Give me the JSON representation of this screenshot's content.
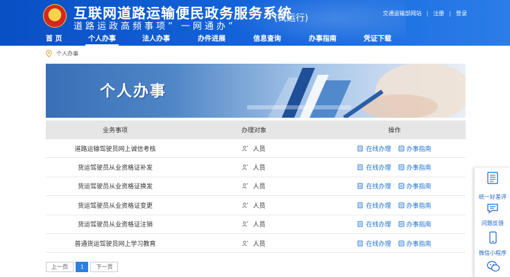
{
  "header": {
    "title": "互联网道路运输便民政务服务系统",
    "slogan": "道路运政高频事项” 一网通办”",
    "trial": "(试运行)",
    "links": [
      "交通运输部网站",
      "注册",
      "登录"
    ],
    "separator": "|"
  },
  "nav": {
    "items": [
      "首 页",
      "个人办事",
      "法人办事",
      "办件进展",
      "信息查询",
      "办事指南",
      "凭证下载"
    ],
    "active_index": 1
  },
  "breadcrumb": {
    "label": "个人办事"
  },
  "banner": {
    "title": "个人办事"
  },
  "table": {
    "headers": [
      "业务事项",
      "办理对象",
      "操作"
    ],
    "rows": [
      {
        "item": "道路运输驾驶员网上诚信考核",
        "target": "人员"
      },
      {
        "item": "货运驾驶员从业资格证补发",
        "target": "人员"
      },
      {
        "item": "货运驾驶员从业资格证换发",
        "target": "人员"
      },
      {
        "item": "货运驾驶员从业资格证变更",
        "target": "人员"
      },
      {
        "item": "货运驾驶员从业资格证注销",
        "target": "人员"
      },
      {
        "item": "普通货运驾驶员网上学习教育",
        "target": "人员"
      }
    ],
    "actions": {
      "online": "在线办理",
      "guide": "办事指南"
    }
  },
  "pager": {
    "prev": "上一页",
    "current": "1",
    "next": "下一页"
  },
  "float_panel": {
    "items": [
      {
        "label": "统一好差评",
        "icon": "rating-icon"
      },
      {
        "label": "问题反馈",
        "icon": "feedback-icon"
      },
      {
        "label": "微信小程序",
        "icon": "mobile-icon"
      },
      {
        "label": "",
        "icon": "wechat-icon"
      }
    ]
  },
  "colors": {
    "header_blue": "#0a4fc4",
    "link_blue": "#1e73d2",
    "pager_active": "#2d7fe0"
  }
}
